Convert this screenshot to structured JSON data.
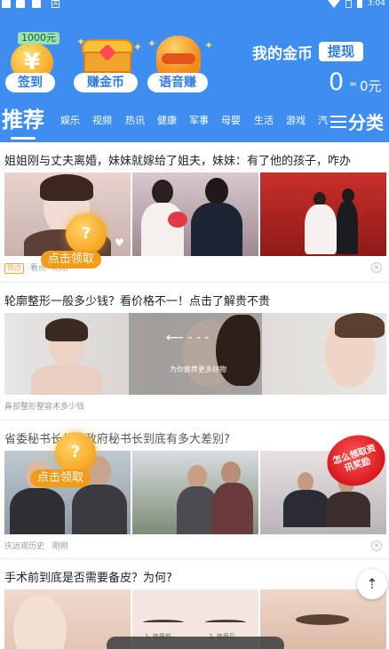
{
  "status_bar": {
    "time": "3:04"
  },
  "header": {
    "features": [
      {
        "badge": "1000元",
        "icon": "yuan-coin-icon",
        "label": "签到"
      },
      {
        "icon": "treasure-chest-icon",
        "label": "赚金币"
      },
      {
        "icon": "voice-helmet-icon",
        "label": "语音赚"
      }
    ],
    "my_coins_label": "我的金币",
    "withdraw_label": "提现",
    "coin_count": "0",
    "approx": "≈",
    "money": "0元"
  },
  "tabs": {
    "active": "推荐",
    "items": [
      "娱乐",
      "视频",
      "热讯",
      "健康",
      "军事",
      "母婴",
      "生活",
      "游戏",
      "汽"
    ],
    "more_label": "分类"
  },
  "articles": [
    {
      "title": "姐姐刚与丈夫离婚，妹妹就嫁给了姐夫，妹妹：有了他的孩子，咋办",
      "tag": "热点",
      "source": "看点",
      "meta_tail": "刚刚"
    },
    {
      "title": "轮廓整形一般多少钱？看价格不一！点击了解贵不贵",
      "ad_caption": "为你推荐更多好物",
      "source": "鼻部整形整容术多少钱"
    },
    {
      "title": "省委秘书长与省政府秘书长到底有多大差别?",
      "corner_badge": "怎么领取资讯奖励",
      "source": "庆远观历史",
      "meta_tail": "刚刚"
    },
    {
      "title": "手术前到底是否需要备皮？为何?",
      "image_captions": [
        "1. 修眉前",
        "2. 修眉后"
      ]
    }
  ],
  "reward_bubble": {
    "symbol": "?",
    "label": "点击领取"
  },
  "colors": {
    "header_blue": "#3d8ef0",
    "reward_orange": "#f59b1a"
  }
}
